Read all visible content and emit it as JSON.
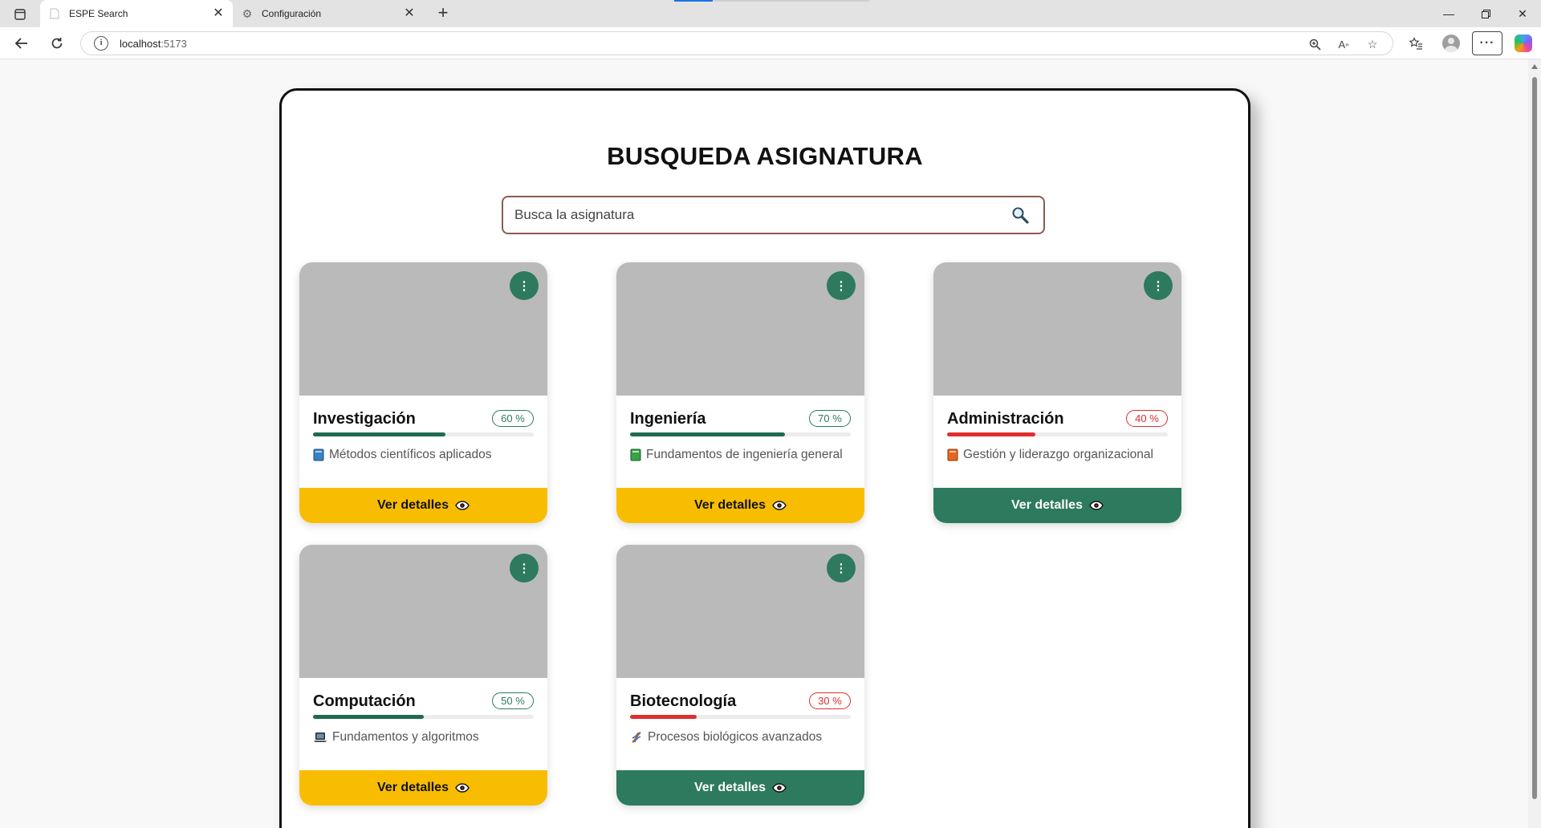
{
  "browser": {
    "tabs": [
      {
        "title": "ESPE Search",
        "icon": "blank-page-icon",
        "active": true
      },
      {
        "title": "Configuración",
        "icon": "gear-icon",
        "active": false
      }
    ],
    "address": {
      "host": "localhost",
      "port": ":5173"
    }
  },
  "page": {
    "title": "BUSQUEDA ASIGNATURA",
    "search_placeholder": "Busca la asignatura",
    "action_label": "Ver detalles"
  },
  "colors": {
    "accent_green": "#2d7a5e",
    "accent_yellow": "#f8bd00",
    "danger_red": "#e02d2d"
  },
  "cards": [
    {
      "title": "Investigación",
      "percent_label": "60 %",
      "progress": 0.6,
      "status": "good",
      "description": "Métodos científicos aplicados",
      "description_icon": "blue-book-icon",
      "button_style": "yellow"
    },
    {
      "title": "Ingeniería",
      "percent_label": "70 %",
      "progress": 0.7,
      "status": "good",
      "description": "Fundamentos de ingeniería general",
      "description_icon": "green-book-icon",
      "button_style": "yellow"
    },
    {
      "title": "Administración",
      "percent_label": "40 %",
      "progress": 0.4,
      "status": "bad",
      "description": "Gestión y liderazgo organizacional",
      "description_icon": "orange-book-icon",
      "button_style": "green"
    },
    {
      "title": "Computación",
      "percent_label": "50 %",
      "progress": 0.5,
      "status": "good",
      "description": "Fundamentos y algoritmos",
      "description_icon": "laptop-icon",
      "button_style": "yellow"
    },
    {
      "title": "Biotecnología",
      "percent_label": "30 %",
      "progress": 0.3,
      "status": "bad",
      "description": "Procesos biológicos avanzados",
      "description_icon": "dna-icon",
      "button_style": "green"
    }
  ]
}
